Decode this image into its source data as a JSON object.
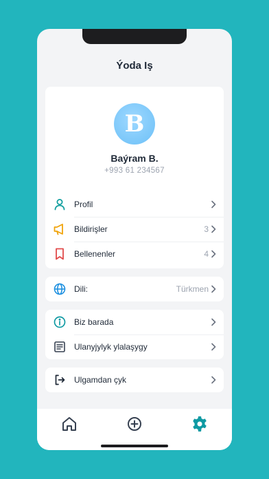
{
  "app": {
    "title": "Ýoda Iş"
  },
  "profile": {
    "initial": "B",
    "name": "Baýram B.",
    "phone": "+993 61 234567"
  },
  "menu": {
    "profile_label": "Profil",
    "notifications_label": "Bildirişler",
    "notifications_count": "3",
    "saved_label": "Bellenenler",
    "saved_count": "4"
  },
  "language": {
    "label": "Dili:",
    "value": "Türkmen"
  },
  "info": {
    "about_label": "Biz barada",
    "terms_label": "Ulanyjylyk ylalaşygy"
  },
  "logout": {
    "label": "Ulgamdan çyk"
  },
  "tabbar": {
    "active": "settings"
  },
  "colors": {
    "background": "#22b5bd",
    "accent": "#0f9aa3",
    "profile_icon": "#14a0a0",
    "notifications_icon": "#f0a30a",
    "saved_icon": "#e24b4b",
    "language_icon": "#1e90e0"
  },
  "icons": {
    "profile": "person-icon",
    "notifications": "megaphone-icon",
    "saved": "bookmark-icon",
    "language": "globe-icon",
    "about": "info-icon",
    "terms": "document-icon",
    "logout": "logout-icon",
    "tab_home": "home-icon",
    "tab_add": "plus-circle-icon",
    "tab_settings": "gear-icon"
  }
}
